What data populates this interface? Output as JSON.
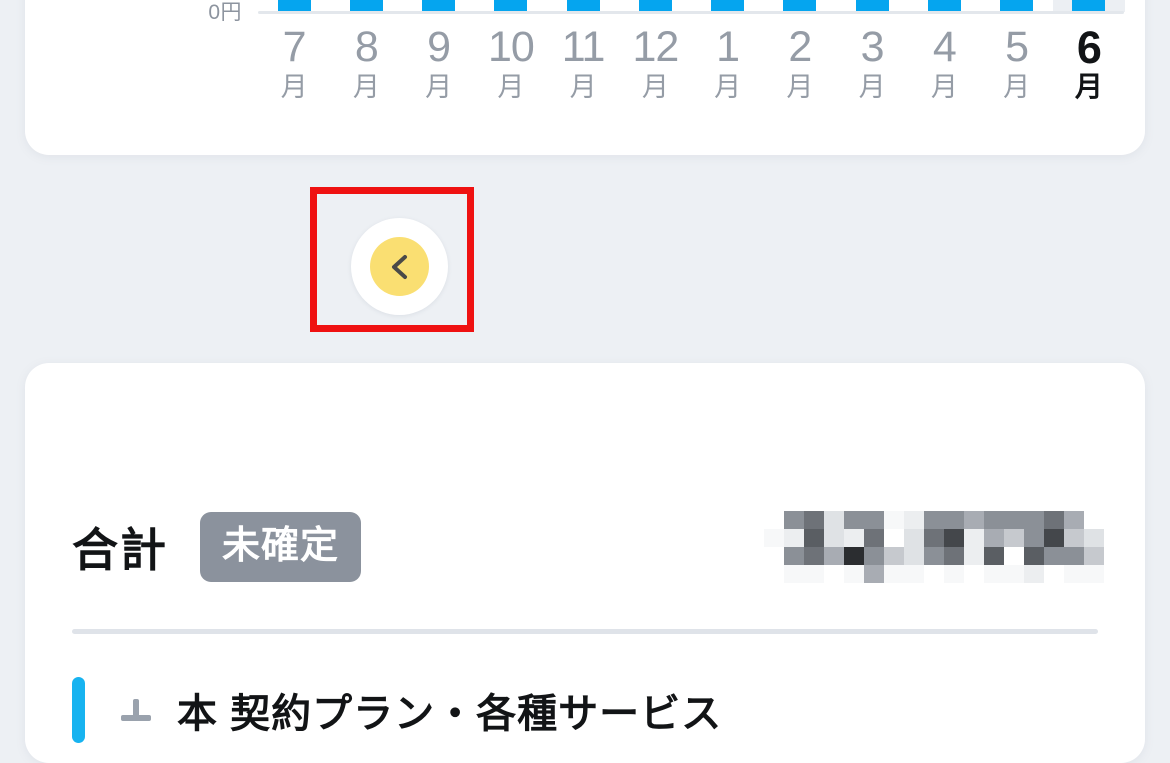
{
  "chart": {
    "y_axis_zero_label": "0円",
    "months": [
      {
        "label": "7",
        "unit": "月",
        "current": false
      },
      {
        "label": "8",
        "unit": "月",
        "current": false
      },
      {
        "label": "9",
        "unit": "月",
        "current": false
      },
      {
        "label": "10",
        "unit": "月",
        "current": false
      },
      {
        "label": "11",
        "unit": "月",
        "current": false
      },
      {
        "label": "12",
        "unit": "月",
        "current": false
      },
      {
        "label": "1",
        "unit": "月",
        "current": false
      },
      {
        "label": "2",
        "unit": "月",
        "current": false
      },
      {
        "label": "3",
        "unit": "月",
        "current": false
      },
      {
        "label": "4",
        "unit": "月",
        "current": false
      },
      {
        "label": "5",
        "unit": "月",
        "current": false
      },
      {
        "label": "6",
        "unit": "月",
        "current": true
      }
    ]
  },
  "chart_data": {
    "type": "bar",
    "title": "",
    "xlabel": "",
    "ylabel": "",
    "categories": [
      "7月",
      "8月",
      "9月",
      "10月",
      "11月",
      "12月",
      "1月",
      "2月",
      "3月",
      "4月",
      "5月",
      "6月"
    ],
    "values": [
      100,
      100,
      100,
      100,
      100,
      100,
      100,
      100,
      100,
      100,
      100,
      100
    ],
    "ylim": [
      0,
      100
    ],
    "tick_labels_y": [
      "0円"
    ],
    "grid": false,
    "legend": "none",
    "bar_color": "#05a5ef",
    "highlighted_category": "6月",
    "note": "Bars are clipped by the top edge of the screenshot; only the lower portion of each bar is visible above the 0円 baseline."
  },
  "navigator": {
    "prev_label": "previous-month",
    "next_label": "next-month",
    "current_month_number": "6",
    "current_month_unit": "月",
    "prev_enabled": true,
    "next_enabled": false,
    "highlight_color": "#ef1111",
    "prev_accent_color": "#fadf72",
    "next_disabled_color": "#c7cbd4"
  },
  "total": {
    "label": "合計",
    "status_badge": "未確定",
    "status_badge_color": "#8b929d",
    "amount_masked": true,
    "amount_text": ""
  },
  "section": {
    "accent_color": "#17b3f0",
    "title": "本 契約プラン・各種サービス"
  }
}
